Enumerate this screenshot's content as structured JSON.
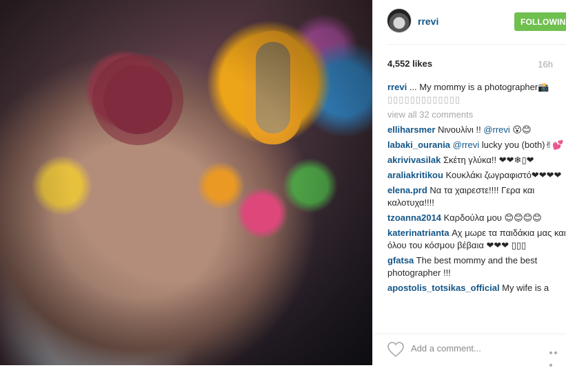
{
  "post": {
    "username": "rrevi",
    "follow_label": "FOLLOWING",
    "likes": "4,552 likes",
    "time": "16h",
    "caption_user": "rrevi",
    "caption_text": " ... My mommy is a photographer📸",
    "caption_tail": "▯▯▯▯▯▯▯▯▯▯▯▯▯",
    "view_all": "view all 32 comments",
    "add_comment_placeholder": "Add a comment...",
    "colors": {
      "follow": "#70c050",
      "link": "#125688"
    },
    "icons": [
      "heart-icon",
      "more-options-icon"
    ]
  },
  "comments": [
    {
      "user": "elliharsmer",
      "mention": "",
      "text": " Νινουλίνι !! ",
      "mention2": "@rrevi",
      "tail": " 😮😊"
    },
    {
      "user": "labaki_ourania",
      "mention": " @rrevi",
      "text": " lucky you (both)✌💕",
      "mention2": "",
      "tail": ""
    },
    {
      "user": "akrivivasilak",
      "mention": "",
      "text": " Σκέτη γλύκα!! ❤❤❄▯❤",
      "mention2": "",
      "tail": ""
    },
    {
      "user": "araliakritikou",
      "mention": "",
      "text": " Κουκλάκι ζωγραφιστό❤❤❤❤",
      "mention2": "",
      "tail": ""
    },
    {
      "user": "elena.prd",
      "mention": "",
      "text": " Να τα χαιρεστε!!!! Γερα και καλοτυχα!!!!",
      "mention2": "",
      "tail": ""
    },
    {
      "user": "tzoanna2014",
      "mention": "",
      "text": " Καρδούλα μου 😊😊😊😊",
      "mention2": "",
      "tail": ""
    },
    {
      "user": "katerinatrianta",
      "mention": "",
      "text": " Αχ μωρε τα παιδάκια μας και όλου του κόσμου βέβαια ❤❤❤ ▯▯▯",
      "mention2": "",
      "tail": ""
    },
    {
      "user": "gfatsa",
      "mention": "",
      "text": " The best mommy and the best photographer !!!",
      "mention2": "",
      "tail": ""
    },
    {
      "user": "apostolis_totsikas_official",
      "mention": "",
      "text": " My wife is a",
      "mention2": "",
      "tail": ""
    }
  ]
}
